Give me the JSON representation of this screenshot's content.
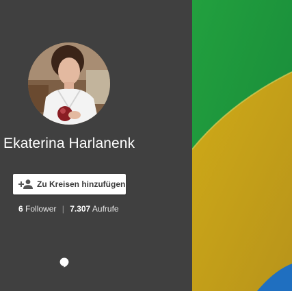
{
  "profile": {
    "name": "Ekaterina Harlanenk",
    "avatar_icon": "profile-photo"
  },
  "actions": {
    "add_to_circles_label": "Zu Kreisen hinzufügen",
    "add_to_circles_icon": "add-person-icon"
  },
  "stats": {
    "followers_count": "6",
    "followers_label": "Follower",
    "separator": "|",
    "views_count": "7.307",
    "views_label": "Aufrufe"
  },
  "hangout": {
    "icon": "hangouts-icon"
  },
  "colors": {
    "sidebar_bg": "#404040",
    "cover_green": "#1e9a3a",
    "cover_yellow": "#c9a816",
    "cover_blue": "#1f6fc0"
  }
}
